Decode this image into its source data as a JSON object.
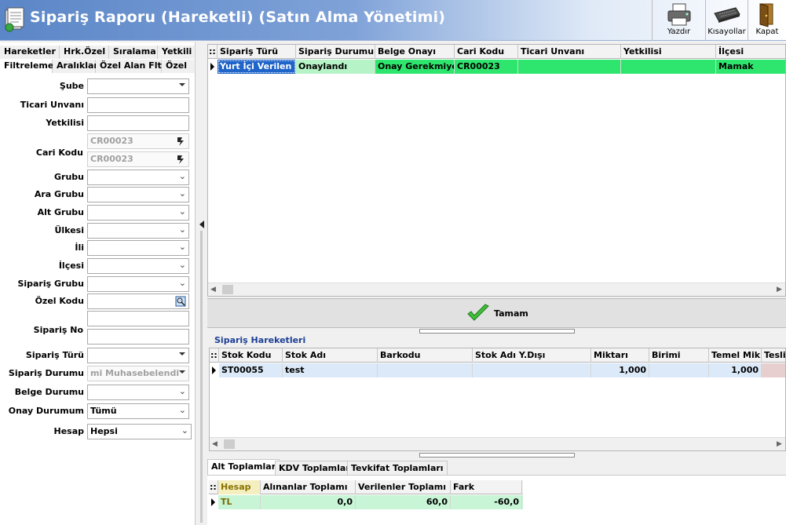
{
  "window": {
    "title": "Sipariş Raporu (Hareketli) (Satın Alma Yönetimi)"
  },
  "toolbar": {
    "print_label": "Yazdır",
    "shortcuts_label": "Kısayollar",
    "close_label": "Kapat"
  },
  "left_tabs": {
    "row1": [
      "Hareketler",
      "Hrk.Özel",
      "Sıralama",
      "Yetkili"
    ],
    "row2": [
      "Filtreleme",
      "Aralıklar",
      "Özel Alan Flt.",
      "Özel"
    ]
  },
  "filters": {
    "sube": {
      "label": "Şube",
      "value": ""
    },
    "ticari_unvani": {
      "label": "Ticari Unvanı",
      "value": ""
    },
    "yetkilisi": {
      "label": "Yetkilisi",
      "value": ""
    },
    "cari_kodu": {
      "label": "Cari Kodu",
      "value1": "CR00023",
      "value2": "CR00023"
    },
    "grubu": {
      "label": "Grubu",
      "value": ""
    },
    "ara_grubu": {
      "label": "Ara Grubu",
      "value": ""
    },
    "alt_grubu": {
      "label": "Alt Grubu",
      "value": ""
    },
    "ulkesi": {
      "label": "Ülkesi",
      "value": ""
    },
    "ili": {
      "label": "İli",
      "value": ""
    },
    "ilcesi": {
      "label": "İlçesi",
      "value": ""
    },
    "siparis_grubu": {
      "label": "Sipariş Grubu",
      "value": ""
    },
    "ozel_kodu": {
      "label": "Özel Kodu",
      "value": ""
    },
    "siparis_no": {
      "label": "Sipariş No",
      "value1": "",
      "value2": ""
    },
    "siparis_turu": {
      "label": "Sipariş Türü",
      "value": ""
    },
    "siparis_durumu": {
      "label": "Sipariş Durumu",
      "value": "mi Muhasebelendi"
    },
    "belge_durumu": {
      "label": "Belge Durumu",
      "value": ""
    },
    "onay_durumum": {
      "label": "Onay Durumum",
      "value": "Tümü"
    },
    "hesap": {
      "label": "Hesap",
      "value": "Hepsi"
    }
  },
  "orders_grid": {
    "columns": [
      "Sipariş Türü",
      "Sipariş Durumu",
      "Belge Onayı",
      "Cari Kodu",
      "Ticari Unvanı",
      "Yetkilisi",
      "İlçesi"
    ],
    "rows": [
      {
        "siparis_turu": "Yurt İçi Verilen",
        "siparis_durumu": "Onaylandı",
        "belge_onayi": "Onay Gerekmiyor",
        "cari_kodu": "CR00023",
        "ticari_unvani": "",
        "yetkilisi": "",
        "ilcesi": "Mamak"
      }
    ]
  },
  "ok_button": {
    "label": "Tamam"
  },
  "movements": {
    "title": "Sipariş Hareketleri",
    "columns": [
      "Stok Kodu",
      "Stok Adı",
      "Barkodu",
      "Stok Adı Y.Dışı",
      "Miktarı",
      "Birimi",
      "Temel Mik.",
      "Teslim"
    ],
    "rows": [
      {
        "stok_kodu": "ST00055",
        "stok_adi": "test",
        "barkodu": "",
        "stok_adi_ydisi": "",
        "miktari": "1,000",
        "birimi": "",
        "temel_mik": "1,000",
        "teslim": ""
      }
    ]
  },
  "bottom_tabs": [
    "Alt Toplamlar",
    "KDV Toplamları",
    "Tevkifat Toplamları"
  ],
  "totals": {
    "columns": [
      "Hesap",
      "Alınanlar Toplamı",
      "Verilenler Toplamı",
      "Fark"
    ],
    "rows": [
      {
        "hesap": "TL",
        "alinanlar": "0,0",
        "verilenler": "60,0",
        "fark": "-60,0"
      }
    ]
  },
  "colors": {
    "row_green": "#2ee66e",
    "row_light_green": "#b6f3c6",
    "selected_blue": "#1f64c8",
    "row_light_blue": "#dbe9f8",
    "title_blue": "#5b86c7"
  }
}
